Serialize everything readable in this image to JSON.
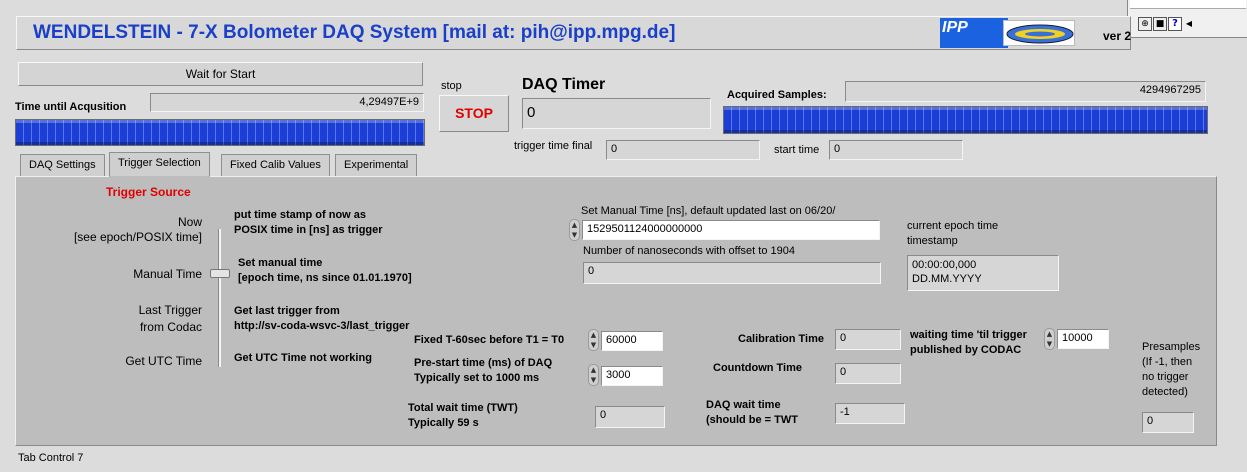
{
  "header": {
    "title": "WENDELSTEIN - 7-X Bolometer DAQ System [mail at: pih@ipp.mpg.de]",
    "ipp_logo_text": "IPP",
    "version": "ver 2",
    "titlebar_buttons": [
      "⊕",
      "🔒",
      "?"
    ]
  },
  "status": {
    "wait_label": "Wait for Start",
    "time_until_label": "Time until Acqusition",
    "time_until_value": "4,29497E+9",
    "time_until_progress": 1.0
  },
  "stop": {
    "label": "stop",
    "button": "STOP"
  },
  "daq_timer": {
    "label": "DAQ Timer",
    "value": "0"
  },
  "acquired": {
    "label": "Acquired Samples:",
    "value": "4294967295",
    "progress": 1.0
  },
  "trigger_time_final": {
    "label": "trigger time final",
    "value": "0"
  },
  "start_time": {
    "label": "start time",
    "value": "0"
  },
  "tabs": [
    {
      "label": "DAQ Settings"
    },
    {
      "label": "Trigger Selection"
    },
    {
      "label": "Fixed Calib Values"
    },
    {
      "label": "Experimental"
    }
  ],
  "active_tab_index": 1,
  "trigger": {
    "source_title": "Trigger Source",
    "slider_options": [
      {
        "label_line1": "Now",
        "label_line2": "[see epoch/POSIX time]"
      },
      {
        "label_line1": "Manual Time",
        "label_line2": ""
      },
      {
        "label_line1": "Last Trigger",
        "label_line2": "from Codac"
      },
      {
        "label_line1": "Get UTC Time",
        "label_line2": ""
      }
    ],
    "selected_option": "Manual Time",
    "descriptions": [
      {
        "line1": "put time stamp of now as",
        "line2": "POSIX time in [ns] as trigger"
      },
      {
        "line1": "Set manual time",
        "line2": "[epoch time, ns since 01.01.1970]"
      },
      {
        "line1": "Get last trigger from",
        "line2": "http://sv-coda-wsvc-3/last_trigger"
      },
      {
        "line1": "Get UTC Time not working",
        "line2": ""
      }
    ],
    "manual_time_label": "Set Manual Time [ns], default updated last on 06/20/",
    "manual_time_value": "1529501124000000000",
    "nanoseconds_label": "Number of nanoseconds with offset to 1904",
    "nanoseconds_value": "0",
    "epoch_label_line1": "current epoch time",
    "epoch_label_line2": "timestamp",
    "epoch_value_line1": "00:00:00,000",
    "epoch_value_line2": "DD.MM.YYYY",
    "fixed_t60_label": "Fixed T-60sec before T1 = T0",
    "fixed_t60_value": "60000",
    "prestart_label_line1": "Pre-start time (ms) of DAQ",
    "prestart_label_line2": "Typically set to 1000 ms",
    "prestart_value": "3000",
    "total_wait_label_line1": "Total wait time (TWT)",
    "total_wait_label_line2": "Typically 59 s",
    "total_wait_value": "0",
    "calibration_time_label": "Calibration Time",
    "calibration_time_value": "0",
    "countdown_time_label": "Countdown Time",
    "countdown_time_value": "0",
    "daq_wait_label_line1": "DAQ wait time",
    "daq_wait_label_line2": "(should be = TWT",
    "daq_wait_value": "-1",
    "waiting_label_line1": "waiting time 'til trigger",
    "waiting_label_line2": "published by CODAC",
    "waiting_value": "10000",
    "presamples_line1": "Presamples",
    "presamples_line2": "(If -1, then",
    "presamples_line3": "no trigger",
    "presamples_line4": "detected)",
    "presamples_value": "0"
  },
  "footer": {
    "tab_control_label": "Tab Control 7"
  },
  "colors": {
    "title_blue": "#1a3fc8",
    "trigger_red": "#e00000",
    "progress_blue": "#1b3fd6",
    "stop_red": "#e00000"
  }
}
